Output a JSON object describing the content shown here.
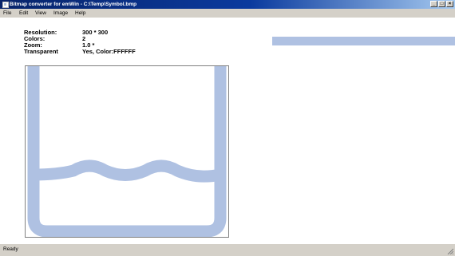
{
  "window": {
    "title": "Bitmap converter for emWin - C:\\Temp\\Symbol.bmp",
    "minimize_glyph": "_",
    "maximize_glyph": "□",
    "close_glyph": "×"
  },
  "menu": [
    "File",
    "Edit",
    "View",
    "Image",
    "Help"
  ],
  "info": {
    "resolution_label": "Resolution:",
    "resolution_value": "300 * 300",
    "colors_label": "Colors:",
    "colors_value": "2",
    "zoom_label": "Zoom:",
    "zoom_value": "1.0 *",
    "transparent_label": "Transparent",
    "transparent_value": "Yes, Color:FFFFFF"
  },
  "palette": {
    "swatch_color": "#afc1e2"
  },
  "status": {
    "text": "Ready"
  }
}
